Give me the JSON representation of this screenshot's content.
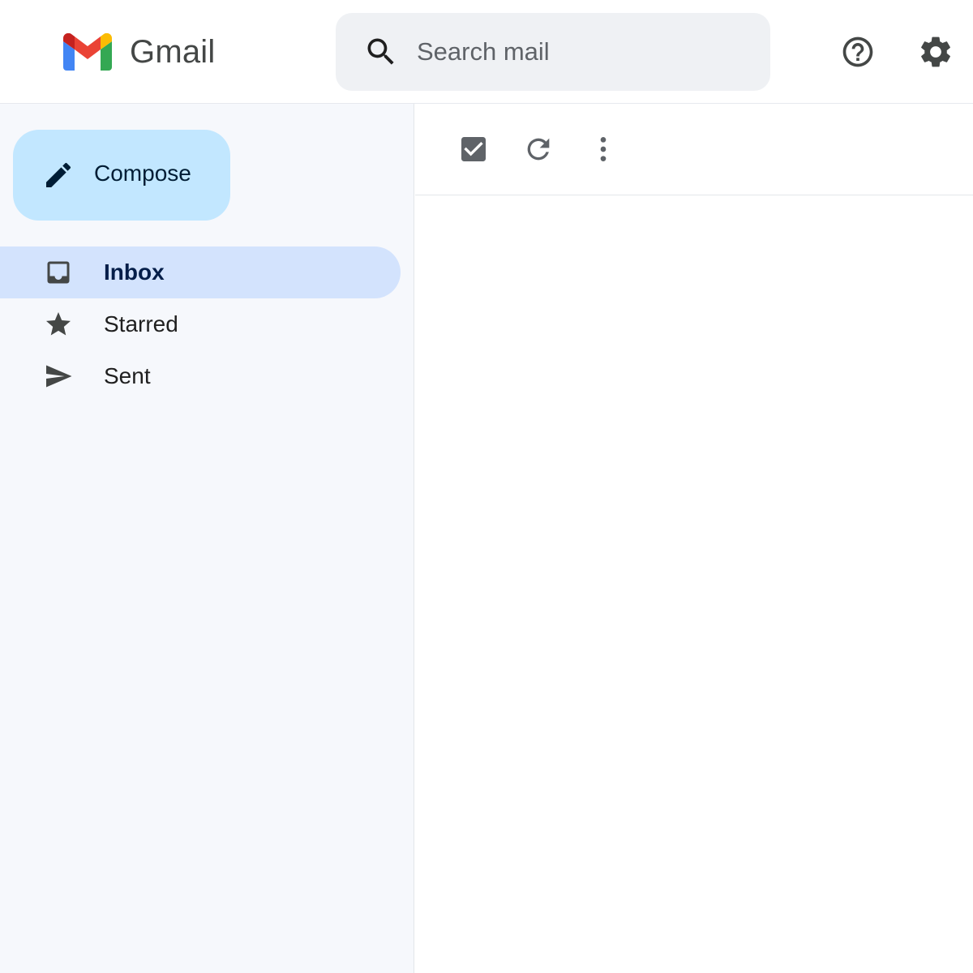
{
  "app": {
    "name": "Gmail",
    "brand_colors": {
      "red": "#ea4335",
      "blue": "#4285f4",
      "green": "#34a853",
      "yellow": "#fbbc04"
    }
  },
  "header": {
    "search": {
      "placeholder": "Search mail",
      "value": "",
      "icon": "search-icon"
    },
    "help_icon": "help-icon",
    "settings_icon": "gear-icon"
  },
  "sidebar": {
    "compose": {
      "label": "Compose",
      "icon": "pencil-icon",
      "background": "#c2e7ff"
    },
    "items": [
      {
        "label": "Inbox",
        "icon": "inbox-icon",
        "active": true
      },
      {
        "label": "Starred",
        "icon": "star-icon",
        "active": false
      },
      {
        "label": "Sent",
        "icon": "send-icon",
        "active": false
      }
    ],
    "active_color": "#d3e3fd"
  },
  "toolbar": {
    "select_all_icon": "checkbox-checked-icon",
    "refresh_icon": "refresh-icon",
    "more_icon": "more-vert-icon"
  }
}
